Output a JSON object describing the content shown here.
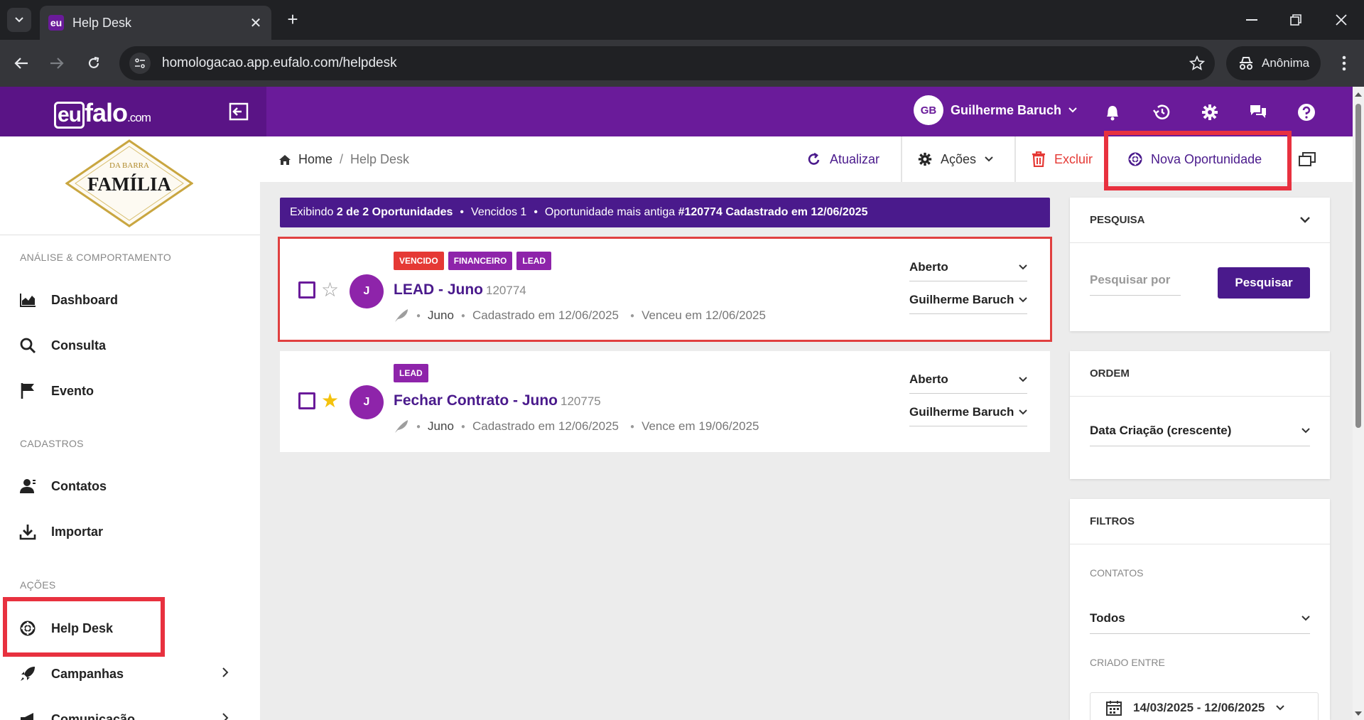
{
  "browser": {
    "tab_title": "Help Desk",
    "favicon_text": "eu",
    "url": "homologacao.app.eufalo.com/helpdesk",
    "incognito_label": "Anônima"
  },
  "header": {
    "logo_eu": "eu",
    "logo_falo": "falo",
    "logo_com": ".com",
    "user_initials": "GB",
    "user_name": "Guilherme Baruch"
  },
  "sidebar": {
    "brand_top": "DA BARRA",
    "brand_name": "FAMÍLIA",
    "sections": [
      {
        "title": "ANÁLISE & COMPORTAMENTO"
      },
      {
        "title": "CADASTROS"
      },
      {
        "title": "AÇÕES"
      }
    ],
    "items": [
      {
        "label": "Dashboard",
        "icon": "chart-area-icon"
      },
      {
        "label": "Consulta",
        "icon": "search-icon"
      },
      {
        "label": "Evento",
        "icon": "flag-icon"
      },
      {
        "label": "Contatos",
        "icon": "contacts-icon"
      },
      {
        "label": "Importar",
        "icon": "download-icon"
      },
      {
        "label": "Help Desk",
        "icon": "lifebuoy-icon"
      },
      {
        "label": "Campanhas",
        "icon": "rocket-icon"
      },
      {
        "label": "Comunicação",
        "icon": "megaphone-icon"
      }
    ]
  },
  "actionbar": {
    "breadcrumb_home": "Home",
    "breadcrumb_sep": "/",
    "breadcrumb_current": "Help Desk",
    "refresh_label": "Atualizar",
    "actions_label": "Ações",
    "delete_label": "Excluir",
    "new_label": "Nova Oportunidade"
  },
  "summary": {
    "prefix": "Exibindo",
    "count": "2 de 2 Oportunidades",
    "overdue": "Vencidos 1",
    "oldest_prefix": "Oportunidade mais antiga",
    "oldest": "#120774 Cadastrado em 12/06/2025"
  },
  "cards": [
    {
      "tags": [
        "VENCIDO",
        "FINANCEIRO",
        "LEAD"
      ],
      "avatar": "J",
      "title": "LEAD - Juno",
      "id": "120774",
      "starred": false,
      "contact": "Juno",
      "created": "Cadastrado em 12/06/2025",
      "due": "Venceu em 12/06/2025",
      "status": "Aberto",
      "owner": "Guilherme Baruch",
      "selected": true
    },
    {
      "tags": [
        "LEAD"
      ],
      "avatar": "J",
      "title": "Fechar Contrato - Juno",
      "id": "120775",
      "starred": true,
      "contact": "Juno",
      "created": "Cadastrado em 12/06/2025",
      "due": "Vence em 19/06/2025",
      "status": "Aberto",
      "owner": "Guilherme Baruch",
      "selected": false
    }
  ],
  "panels": {
    "search_title": "PESQUISA",
    "search_placeholder": "Pesquisar por",
    "search_button": "Pesquisar",
    "order_title": "ORDEM",
    "order_value": "Data Criação (crescente)",
    "filters_title": "FILTROS",
    "contacts_label": "CONTATOS",
    "contacts_value": "Todos",
    "created_label": "CRIADO ENTRE",
    "date_range": "14/03/2025 - 12/06/2025"
  },
  "colors": {
    "brand_purple": "#6a1b9a",
    "dark_purple": "#4a1a8c",
    "danger": "#e53935",
    "highlight_red": "#e8313f"
  }
}
